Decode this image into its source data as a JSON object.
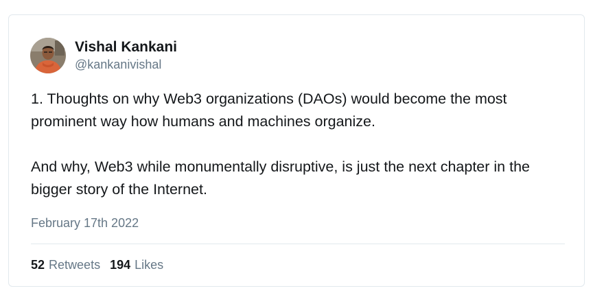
{
  "author": {
    "display_name": "Vishal Kankani",
    "handle": "@kankanivishal"
  },
  "tweet": {
    "paragraphs": [
      "1. Thoughts on why Web3 organizations (DAOs) would become the most prominent way how humans and machines organize.",
      "And why, Web3 while monumentally disruptive, is just the next chapter in the bigger story of the Internet."
    ],
    "date": "February 17th 2022"
  },
  "stats": {
    "retweets_count": "52",
    "retweets_label": "Retweets",
    "likes_count": "194",
    "likes_label": "Likes"
  },
  "colors": {
    "text_primary": "#14171a",
    "text_secondary": "#657786",
    "border": "#e1e8ed"
  },
  "icons": {
    "avatar": "user-avatar-photo"
  }
}
